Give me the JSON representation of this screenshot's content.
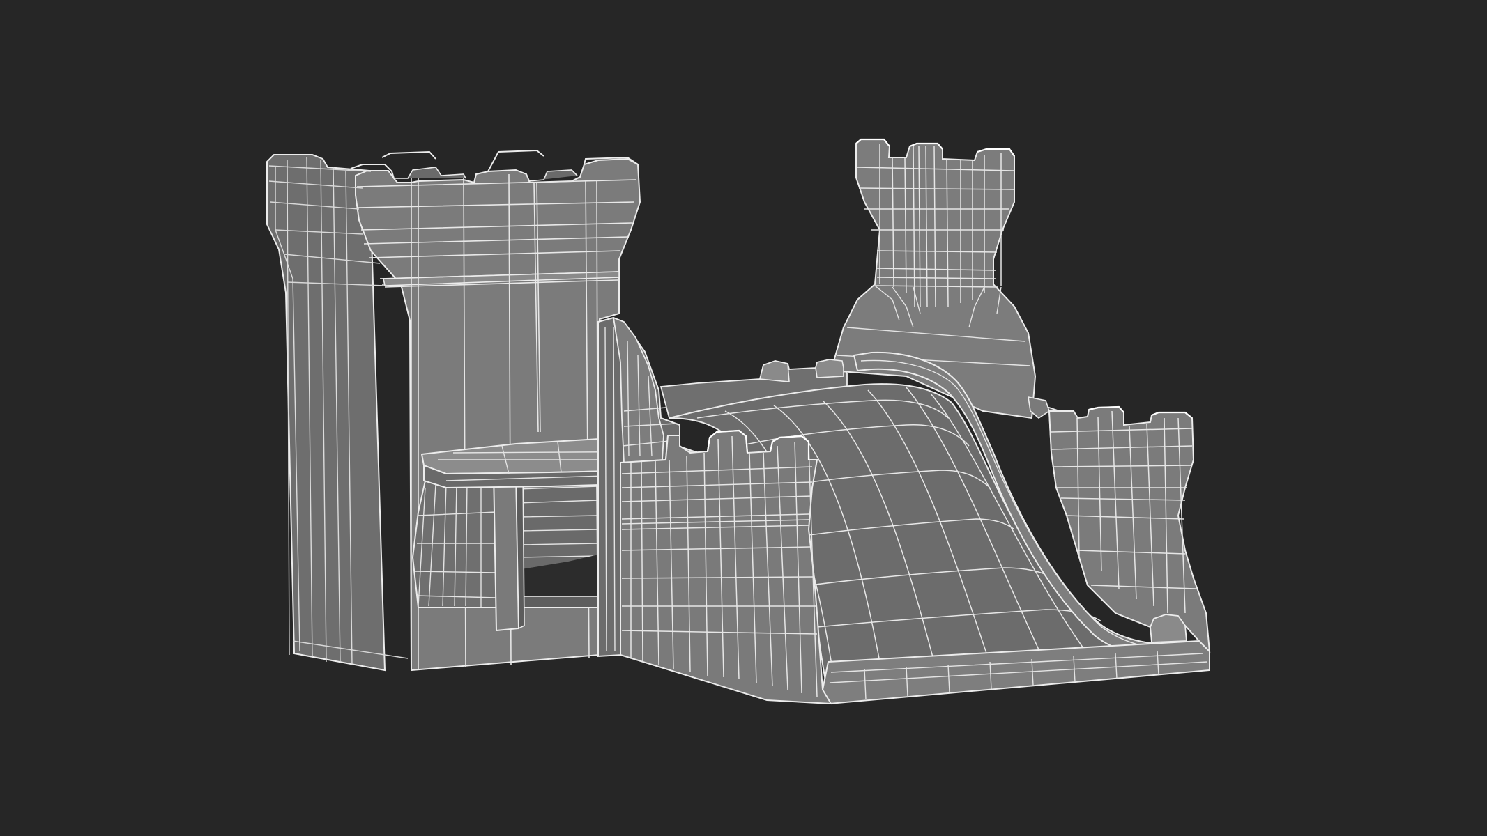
{
  "scene": {
    "subject": "",
    "colors": {
      "background": "#262626",
      "surface": "#727272",
      "surface_light": "#8a8a8a",
      "surface_dark": "#5a5a5a",
      "shadow": "#3e3e3e",
      "wire": "#ececec",
      "wire_soft": "#c9c9c9"
    }
  }
}
